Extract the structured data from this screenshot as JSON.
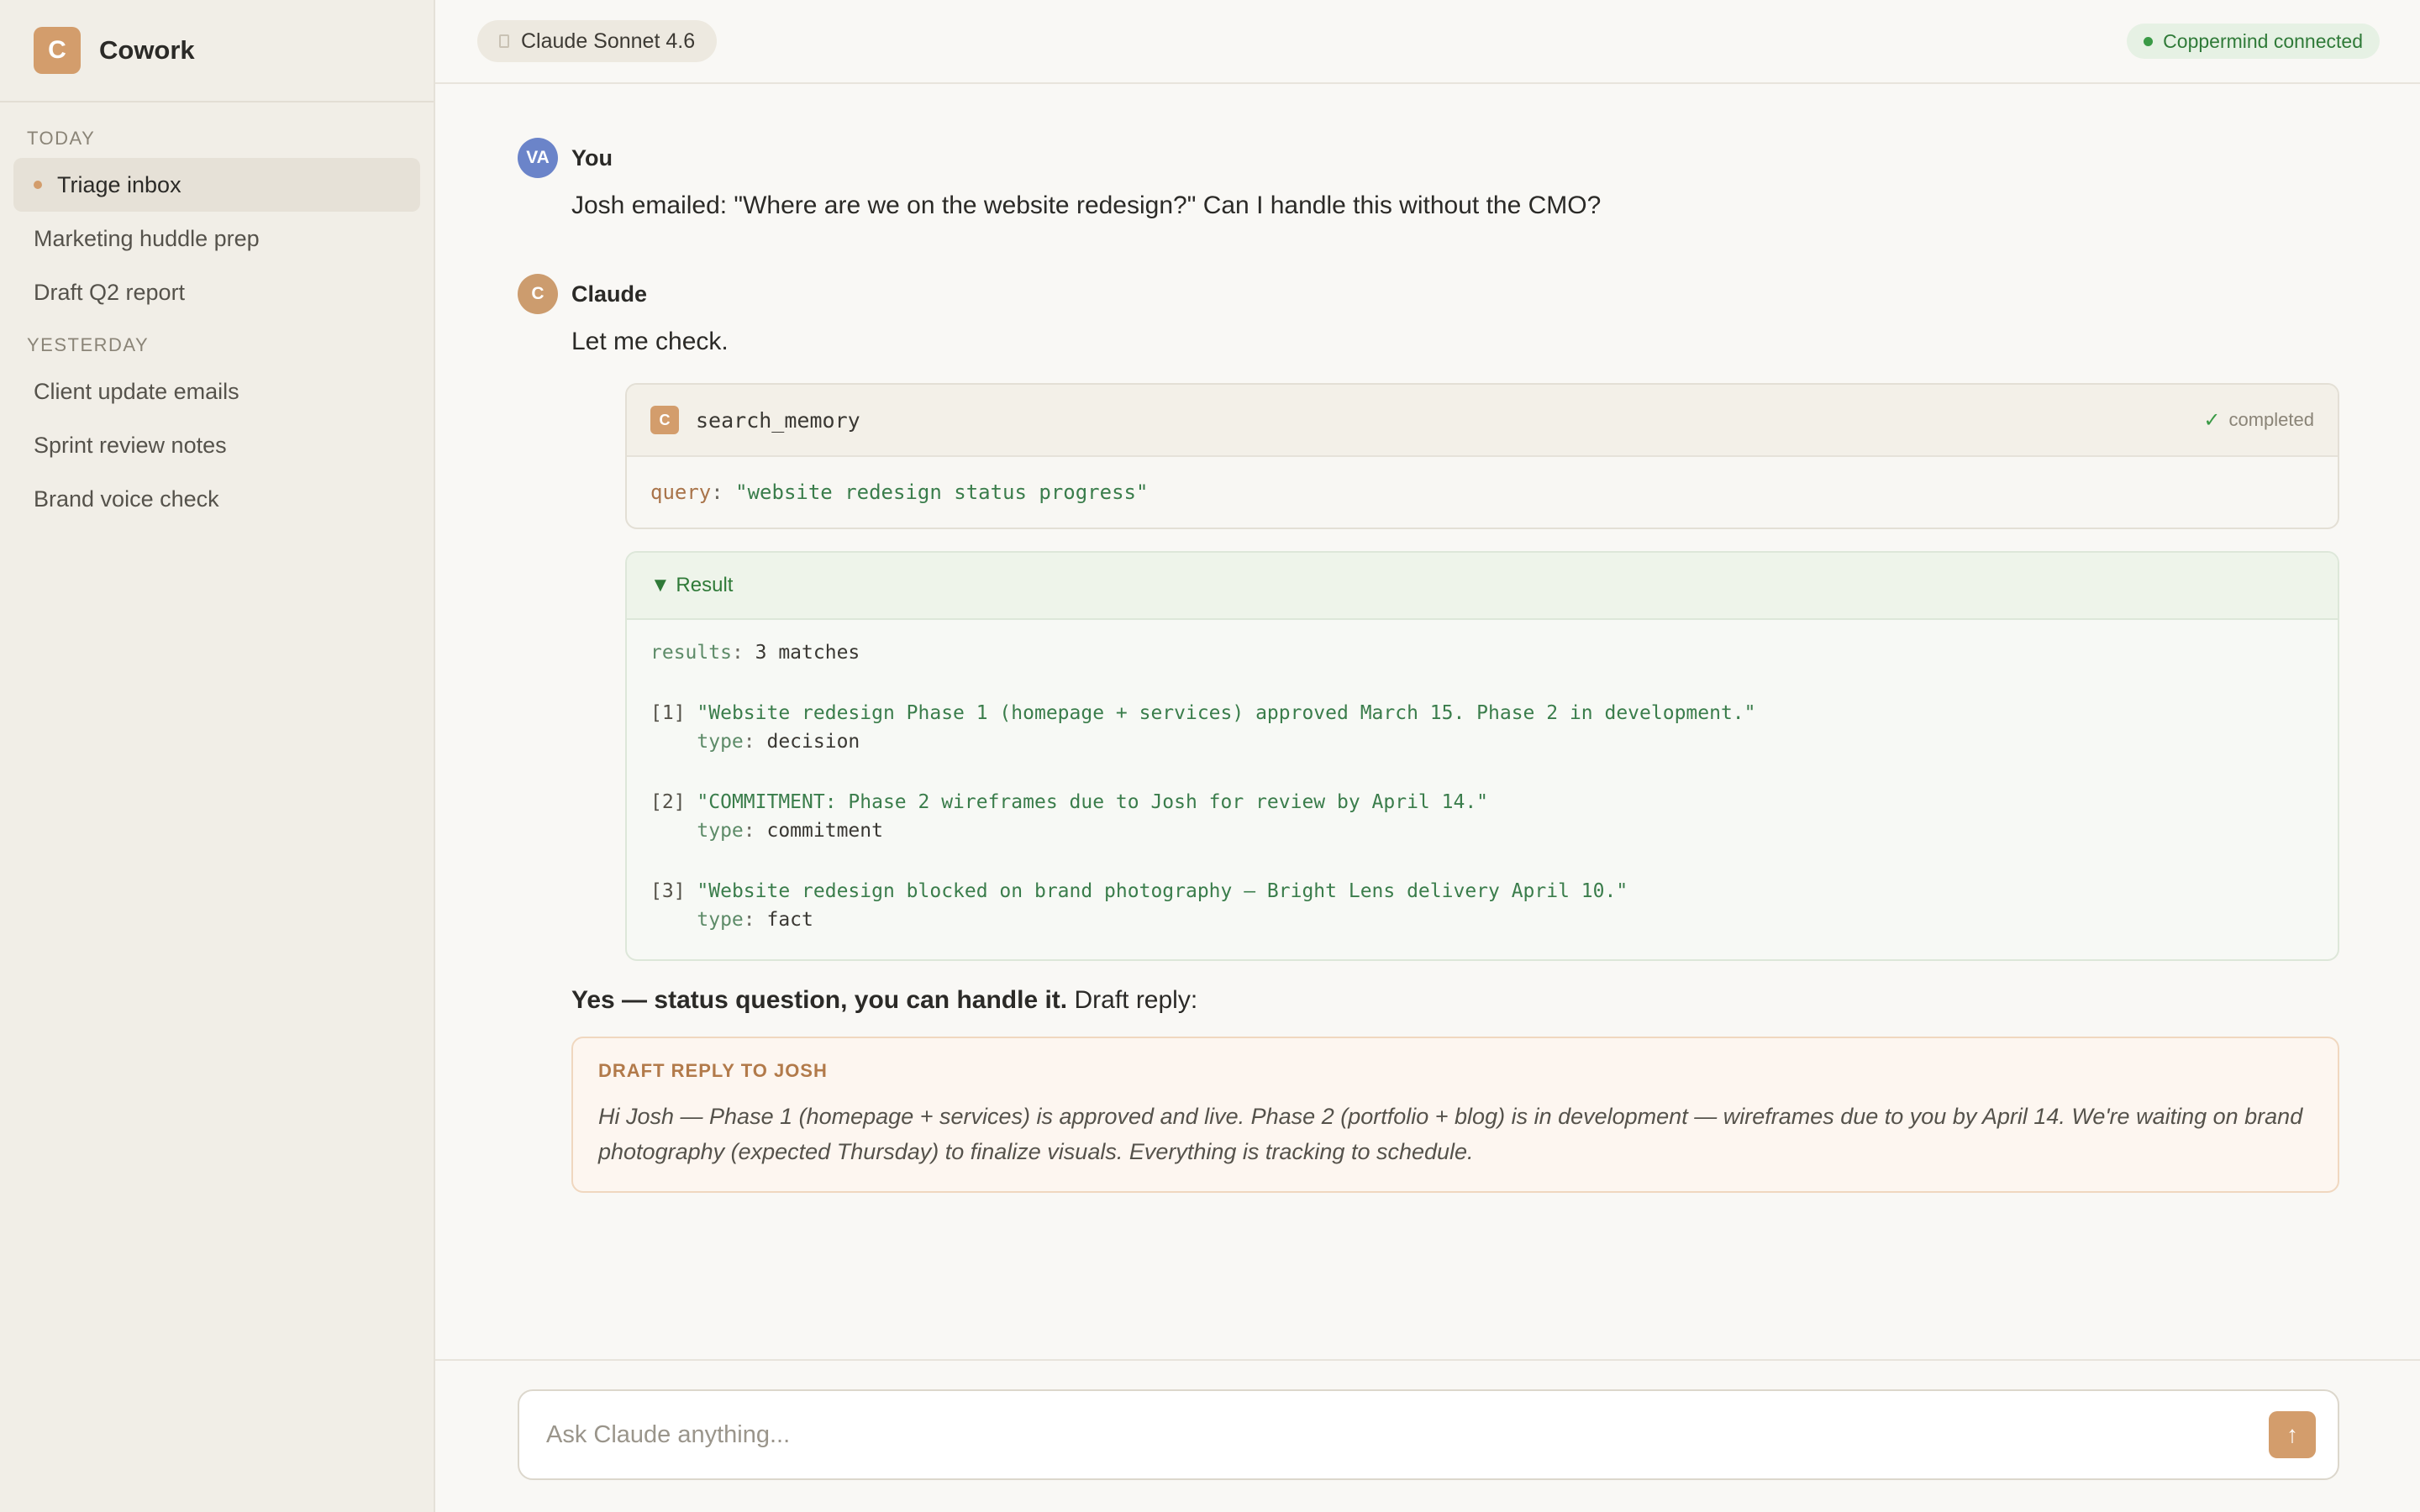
{
  "sidebar": {
    "brand_initial": "C",
    "brand_name": "Cowork",
    "section_today": "TODAY",
    "section_yesterday": "YESTERDAY",
    "today_items": [
      {
        "label": "Triage inbox"
      },
      {
        "label": "Marketing huddle prep"
      },
      {
        "label": "Draft Q2 report"
      }
    ],
    "yesterday_items": [
      {
        "label": "Client update emails"
      },
      {
        "label": "Sprint review notes"
      },
      {
        "label": "Brand voice check"
      }
    ]
  },
  "header": {
    "model": "Claude Sonnet 4.6",
    "connection_status": "Coppermind connected"
  },
  "conversation": {
    "user": {
      "initials": "VA",
      "name": "You",
      "text": "Josh emailed: \"Where are we on the website redesign?\" Can I handle this without the CMO?"
    },
    "assistant": {
      "initial": "C",
      "name": "Claude",
      "intro": "Let me check.",
      "tool": {
        "icon_initial": "C",
        "name": "search_memory",
        "status": "completed",
        "param_key": "query",
        "param_value": "\"website redesign status progress\""
      },
      "result": {
        "toggle": "▼ Result",
        "summary_key": "results",
        "summary_value": "3 matches",
        "items": [
          {
            "index": "[1]",
            "text": "\"Website redesign Phase 1 (homepage + services) approved March 15. Phase 2 in development.\"",
            "type_key": "type",
            "type_value": "decision"
          },
          {
            "index": "[2]",
            "text": "\"COMMITMENT: Phase 2 wireframes due to Josh for review by April 14.\"",
            "type_key": "type",
            "type_value": "commitment"
          },
          {
            "index": "[3]",
            "text": "\"Website redesign blocked on brand photography — Bright Lens delivery April 10.\"",
            "type_key": "type",
            "type_value": "fact"
          }
        ]
      },
      "answer_bold": "Yes — status question, you can handle it.",
      "answer_rest": " Draft reply:",
      "draft": {
        "label": "DRAFT REPLY TO JOSH",
        "text": "Hi Josh — Phase 1 (homepage + services) is approved and live. Phase 2 (portfolio + blog) is in development — wireframes due to you by April 14. We're waiting on brand photography (expected Thursday) to finalize visuals. Everything is tracking to schedule."
      }
    }
  },
  "composer": {
    "placeholder": "Ask Claude anything...",
    "send_icon": "arrow-up-icon"
  },
  "colors": {
    "accent": "#d39d6c",
    "status_green": "#3a9a46",
    "user_avatar": "#6b84c9"
  }
}
